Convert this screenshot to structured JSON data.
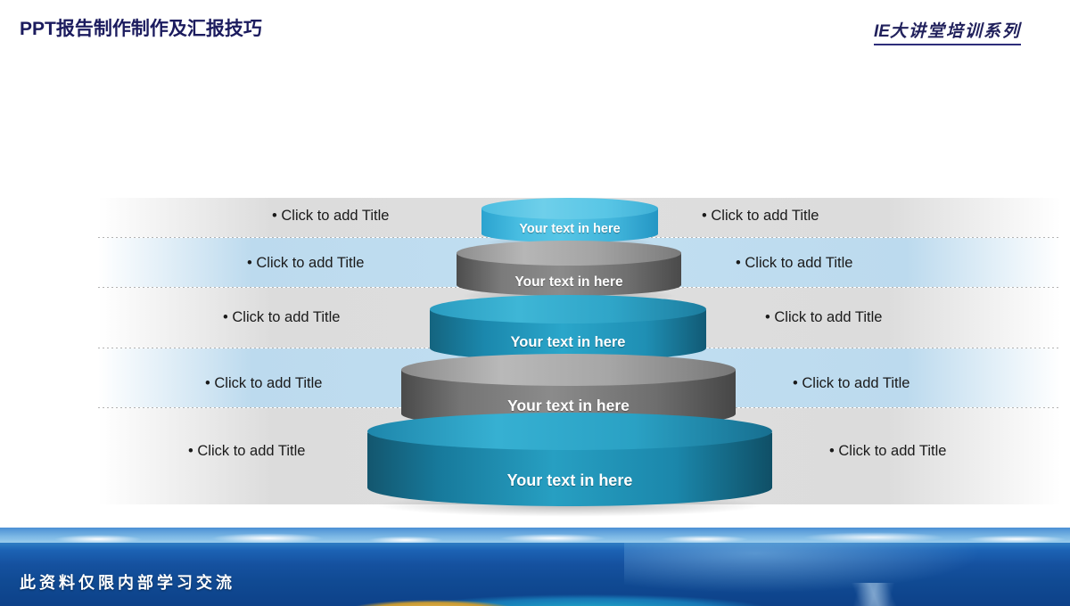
{
  "header": {
    "title": "PPT报告制作制作及汇报技巧",
    "brand_prefix": "IE",
    "brand_suffix": "大讲堂培训系列",
    "title_color": "#1b1b5e",
    "brand_color": "#21215c"
  },
  "diagram": {
    "type": "stacked-cylinder-pyramid",
    "levels": [
      {
        "index": 1,
        "label": "Your text in here",
        "left_title": "• Click to add Title",
        "right_title": "• Click to add Title",
        "color": "#3cb4dc",
        "color_name": "light-blue",
        "band_style": "gray"
      },
      {
        "index": 2,
        "label": "Your text in here",
        "left_title": "• Click to add Title",
        "right_title": "• Click to add Title",
        "color": "#767676",
        "color_name": "gray",
        "band_style": "blue"
      },
      {
        "index": 3,
        "label": "Your text in here",
        "left_title": "• Click to add Title",
        "right_title": "• Click to add Title",
        "color": "#1f93bd",
        "color_name": "teal-blue",
        "band_style": "gray"
      },
      {
        "index": 4,
        "label": "Your text in here",
        "left_title": "• Click to add Title",
        "right_title": "• Click to add Title",
        "color": "#6e6e6e",
        "color_name": "gray",
        "band_style": "blue"
      },
      {
        "index": 5,
        "label": "Your text in here",
        "left_title": "• Click to add Title",
        "right_title": "• Click to add Title",
        "color": "#1b88b4",
        "color_name": "deep-teal",
        "band_style": "gray"
      }
    ]
  },
  "footer": {
    "note": "此资料仅限内部学习交流",
    "note_color": "#ffffff",
    "background": "ocean-photo"
  }
}
